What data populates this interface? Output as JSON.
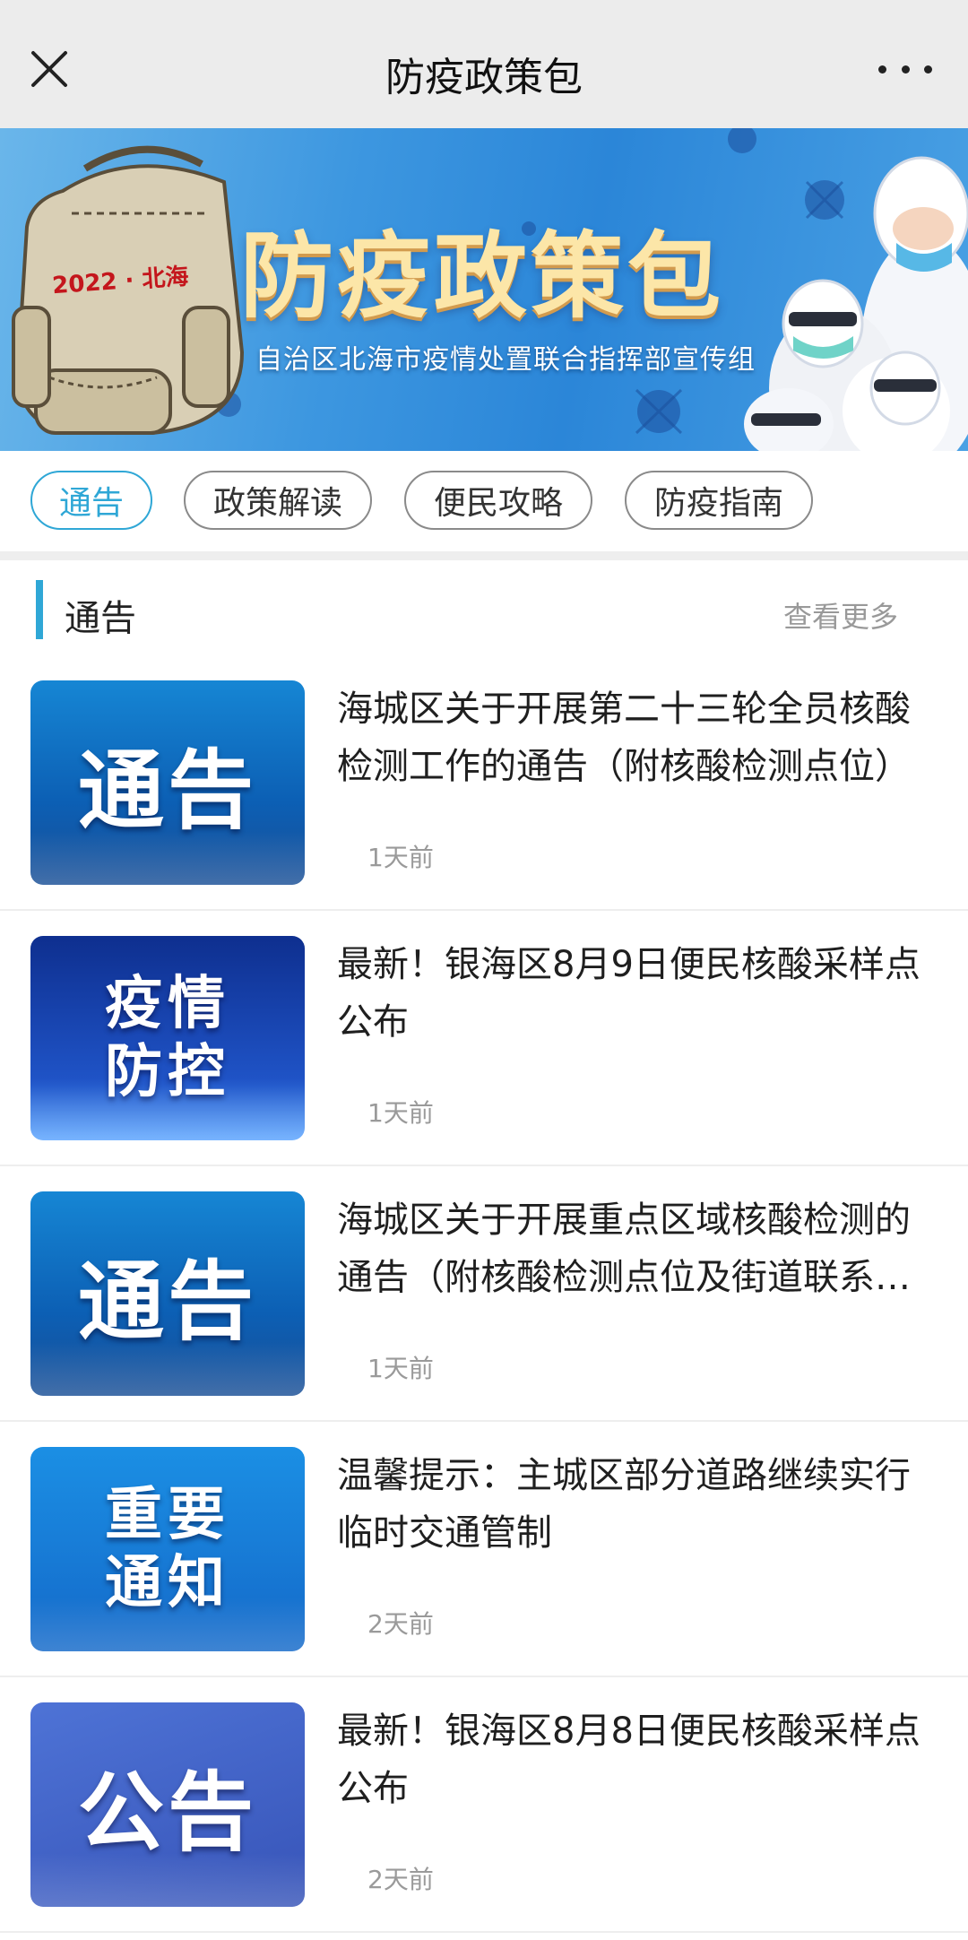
{
  "nav": {
    "title": "防疫政策包",
    "close_icon": "close-icon",
    "more_icon": "more-icon"
  },
  "banner": {
    "title": "防疫政策包",
    "subtitle": "自治区北海市疫情处置联合指挥部宣传组",
    "bag_label": "2022 · 北海"
  },
  "tabs": [
    {
      "label": "通告",
      "active": true
    },
    {
      "label": "政策解读",
      "active": false
    },
    {
      "label": "便民攻略",
      "active": false
    },
    {
      "label": "防疫指南",
      "active": false
    }
  ],
  "section": {
    "title": "通告",
    "more": "查看更多"
  },
  "items": [
    {
      "thumb": "通告",
      "title": "海城区关于开展第二十三轮全员核酸检测工作的通告（附核酸检测点位）",
      "time": "1天前"
    },
    {
      "thumb": "疫情防控",
      "title": "最新！银海区8月9日便民核酸采样点公布",
      "time": "1天前"
    },
    {
      "thumb": "通告",
      "title": "海城区关于开展重点区域核酸检测的通告（附核酸检测点位及街道联系方式）",
      "time": "1天前"
    },
    {
      "thumb": "重要通知",
      "title": "温馨提示：主城区部分道路继续实行临时交通管制",
      "time": "2天前"
    },
    {
      "thumb": "公告",
      "title": "最新！银海区8月8日便民核酸采样点公布",
      "time": "2天前"
    }
  ],
  "colors": {
    "accent": "#2fa7d6",
    "navbar_bg": "#ececec",
    "time_text": "#9a9a9a"
  }
}
